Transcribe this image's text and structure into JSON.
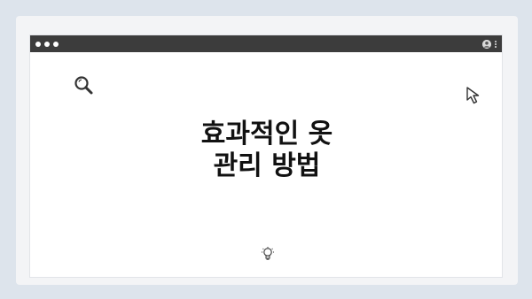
{
  "window": {
    "controls": [
      "close",
      "minimize",
      "maximize"
    ],
    "titlebar_color": "#3c3c3c"
  },
  "content": {
    "title_line1": "효과적인 옷",
    "title_line2": "관리 방법"
  },
  "icons": {
    "search": "search-icon",
    "cursor": "cursor-icon",
    "bulb": "lightbulb-icon",
    "user": "user-icon",
    "menu": "kebab-menu-icon"
  },
  "colors": {
    "background": "#dde4ec",
    "card": "#f3f4f6",
    "window": "#ffffff",
    "text": "#111111"
  }
}
